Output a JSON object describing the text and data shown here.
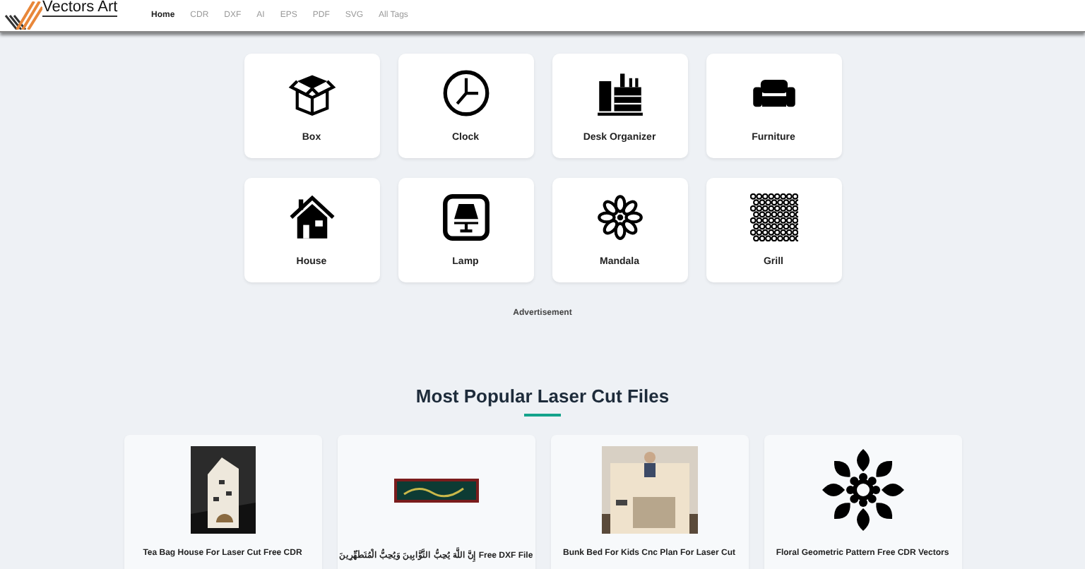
{
  "header": {
    "logo": "Vectors Art",
    "nav": [
      {
        "label": "Home",
        "selected": true
      },
      {
        "label": "CDR",
        "selected": false
      },
      {
        "label": "DXF",
        "selected": false
      },
      {
        "label": "AI",
        "selected": false
      },
      {
        "label": "EPS",
        "selected": false
      },
      {
        "label": "PDF",
        "selected": false
      },
      {
        "label": "SVG",
        "selected": false
      },
      {
        "label": "All Tags",
        "selected": false
      }
    ]
  },
  "categories": [
    {
      "label": "Box",
      "kind": "box"
    },
    {
      "label": "Clock",
      "kind": "clock"
    },
    {
      "label": "Desk Organizer",
      "kind": "desk"
    },
    {
      "label": "Furniture",
      "kind": "sofa"
    },
    {
      "label": "House",
      "kind": "house"
    },
    {
      "label": "Lamp",
      "kind": "lamp"
    },
    {
      "label": "Mandala",
      "kind": "mandala"
    },
    {
      "label": "Grill",
      "kind": "grill"
    }
  ],
  "advertisement": "Advertisement",
  "popular": {
    "title": "Most Popular Laser Cut Files",
    "items": [
      {
        "title": "Tea Bag House For Laser Cut Free CDR",
        "kind": "picture"
      },
      {
        "title": "إِنَّ اللَّهَ يُحِبُّ التَّوَّابِينَ وَيُحِبُّ الْمُتَطَهِّرِينَ Free DXF File",
        "kind": "picture"
      },
      {
        "title": "Bunk Bed For Kids Cnc Plan For Laser Cut",
        "kind": "picture"
      },
      {
        "title": "Floral Geometric Pattern Free CDR Vectors",
        "kind": "pattern"
      }
    ]
  }
}
